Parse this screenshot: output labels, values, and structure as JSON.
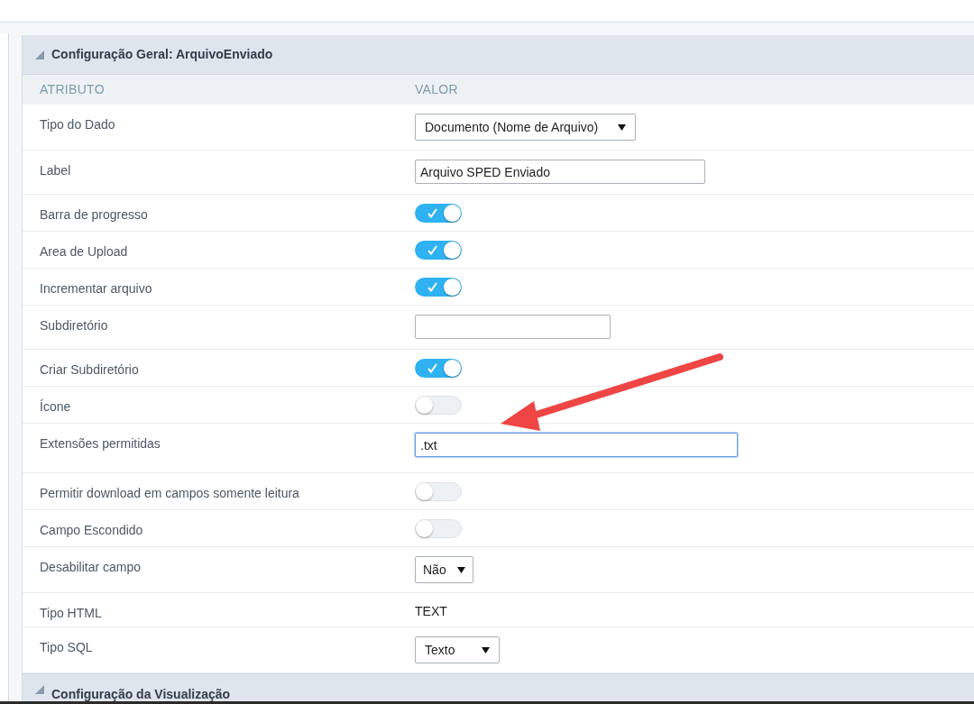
{
  "section": {
    "title": "Configuração Geral: ArquivoEnviado",
    "expanded": true
  },
  "columns": [
    "ATRIBUTO",
    "VALOR"
  ],
  "rows": [
    {
      "label": "Tipo do Dado",
      "kind": "select",
      "value": "Documento (Nome de Arquivo)"
    },
    {
      "label": "Label",
      "kind": "text",
      "value": "Arquivo SPED Enviado",
      "focused": false
    },
    {
      "label": "Barra de progresso",
      "kind": "toggle",
      "on": true
    },
    {
      "label": "Area de Upload",
      "kind": "toggle",
      "on": true
    },
    {
      "label": "Incrementar arquivo",
      "kind": "toggle",
      "on": true
    },
    {
      "label": "Subdiretório",
      "kind": "text",
      "focused": false
    },
    {
      "label": "Criar Subdiretório",
      "kind": "toggle",
      "on": true
    },
    {
      "label": "Ícone",
      "kind": "toggle",
      "on": false
    },
    {
      "label": "Extensões permitidas",
      "kind": "text",
      "value": ".txt",
      "focused": true
    },
    {
      "label": "Permitir download em campos somente leitura",
      "kind": "toggle",
      "on": false
    },
    {
      "label": "Campo Escondido",
      "kind": "toggle",
      "on": false
    },
    {
      "label": "Desabilitar campo",
      "kind": "select",
      "value": "Não"
    },
    {
      "label": "Tipo HTML",
      "kind": "static",
      "value": "TEXT"
    },
    {
      "label": "Tipo SQL",
      "kind": "select",
      "value": "Texto"
    }
  ],
  "next_section": {
    "title": "Configuração da Visualização",
    "expanded": true
  }
}
